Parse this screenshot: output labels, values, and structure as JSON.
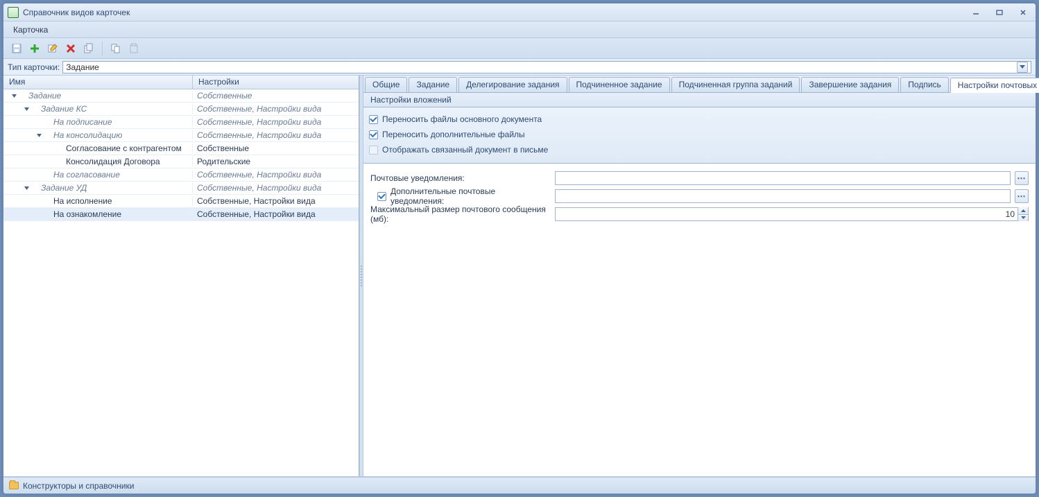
{
  "window": {
    "title": "Справочник видов карточек"
  },
  "menubar": {
    "card": "Карточка"
  },
  "type_row": {
    "label": "Тип карточки:",
    "value": "Задание"
  },
  "columns": {
    "name": "Имя",
    "settings": "Настройки"
  },
  "tree": [
    {
      "indent": 0,
      "expander": "down",
      "label": "Задание",
      "italic": true,
      "settings": "Собственные",
      "sitalic": true,
      "selected": false
    },
    {
      "indent": 1,
      "expander": "down",
      "label": "Задание КС",
      "italic": true,
      "settings": "Собственные, Настройки вида",
      "sitalic": true,
      "selected": false
    },
    {
      "indent": 2,
      "expander": "none",
      "label": "На подписание",
      "italic": true,
      "settings": "Собственные, Настройки вида",
      "sitalic": true,
      "selected": false
    },
    {
      "indent": 2,
      "expander": "down",
      "label": "На консолидацию",
      "italic": true,
      "settings": "Собственные, Настройки вида",
      "sitalic": true,
      "selected": false
    },
    {
      "indent": 3,
      "expander": "none",
      "label": "Согласование с контрагентом",
      "italic": false,
      "settings": "Собственные",
      "sitalic": false,
      "selected": false
    },
    {
      "indent": 3,
      "expander": "none",
      "label": "Консолидация Договора",
      "italic": false,
      "settings": "Родительские",
      "sitalic": false,
      "selected": false
    },
    {
      "indent": 2,
      "expander": "none",
      "label": "На согласование",
      "italic": true,
      "settings": "Собственные, Настройки вида",
      "sitalic": true,
      "selected": false
    },
    {
      "indent": 1,
      "expander": "down",
      "label": "Задание УД",
      "italic": true,
      "settings": "Собственные, Настройки вида",
      "sitalic": true,
      "selected": false
    },
    {
      "indent": 2,
      "expander": "none",
      "label": "На исполнение",
      "italic": false,
      "settings": "Собственные, Настройки вида",
      "sitalic": false,
      "selected": false
    },
    {
      "indent": 2,
      "expander": "none",
      "label": "На ознакомление",
      "italic": false,
      "settings": "Собственные, Настройки вида",
      "sitalic": false,
      "selected": true
    }
  ],
  "tabs": [
    {
      "label": "Общие",
      "active": false
    },
    {
      "label": "Задание",
      "active": false
    },
    {
      "label": "Делегирование задания",
      "active": false
    },
    {
      "label": "Подчиненное задание",
      "active": false
    },
    {
      "label": "Подчиненная группа заданий",
      "active": false
    },
    {
      "label": "Завершение задания",
      "active": false
    },
    {
      "label": "Подпись",
      "active": false
    },
    {
      "label": "Настройки почтовых уведомлений",
      "active": true
    }
  ],
  "attachments": {
    "header": "Настройки вложений",
    "cb1": {
      "label": "Переносить файлы основного документа",
      "checked": true,
      "disabled": false
    },
    "cb2": {
      "label": "Переносить дополнительные файлы",
      "checked": true,
      "disabled": false
    },
    "cb3": {
      "label": "Отображать связанный документ в письме",
      "checked": false,
      "disabled": true
    }
  },
  "form": {
    "mail_label": "Почтовые уведомления:",
    "mail_value": "",
    "extra_chk": true,
    "extra_label": "Дополнительные почтовые уведомления:",
    "extra_value": "",
    "size_label": "Максимальный размер почтового сообщения (мб):",
    "size_value": "10"
  },
  "status": {
    "label": "Конструкторы и справочники"
  }
}
